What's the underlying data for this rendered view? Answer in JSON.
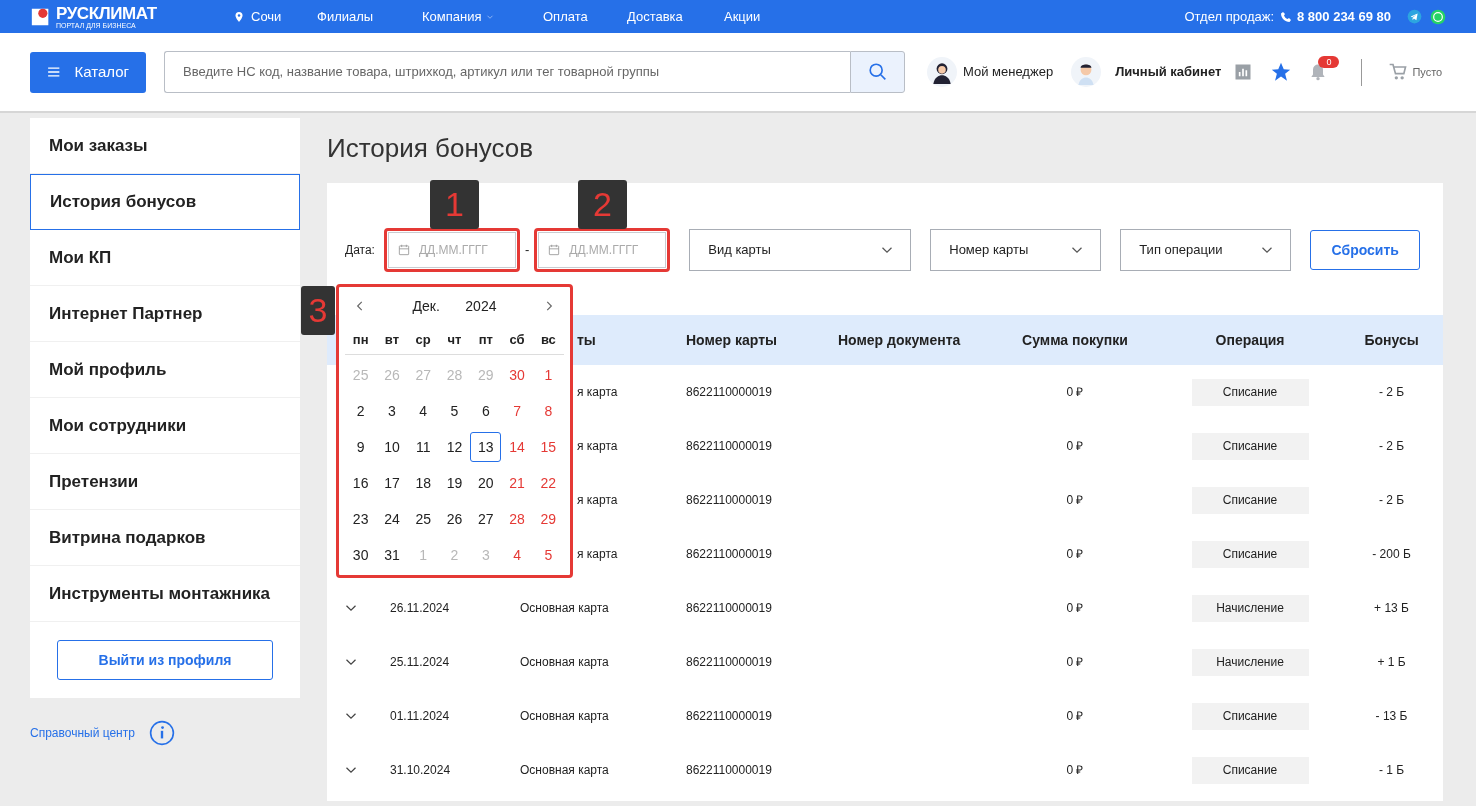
{
  "topbar": {
    "logo": "РУСКЛИМАТ",
    "logo_sub": "ПОРТАЛ ДЛЯ БИЗНЕСА",
    "city": "Сочи",
    "links": [
      {
        "label": "Филиалы",
        "dropdown": false
      },
      {
        "label": "Компания",
        "dropdown": true
      },
      {
        "label": "Оплата",
        "dropdown": false
      },
      {
        "label": "Доставка",
        "dropdown": false
      },
      {
        "label": "Акции",
        "dropdown": false
      }
    ],
    "sales_label": "Отдел продаж:",
    "phone": "8 800 234 69 80"
  },
  "header": {
    "catalog": "Каталог",
    "search_placeholder": "Введите НС код, название товара, штрихкод, артикул или тег товарной группы",
    "manager": "Мой менеджер",
    "cabinet": "Личный кабинет",
    "notifications": "0",
    "cart": "Пусто"
  },
  "sidebar": {
    "items": [
      {
        "label": "Мои заказы",
        "selected": false
      },
      {
        "label": "История бонусов",
        "selected": true
      },
      {
        "label": "Мои КП",
        "selected": false
      },
      {
        "label": "Интернет Партнер",
        "selected": false
      },
      {
        "label": "Мой профиль",
        "selected": false
      },
      {
        "label": "Мои сотрудники",
        "selected": false
      },
      {
        "label": "Претензии",
        "selected": false
      },
      {
        "label": "Витрина подарков",
        "selected": false
      },
      {
        "label": "Инструменты монтажника",
        "selected": false
      }
    ],
    "logout": "Выйти из профиля",
    "help": "Справочный центр"
  },
  "page_title": "История бонусов",
  "filters": {
    "date_label": "Дата:",
    "date_from_placeholder": "ДД.ММ.ГГГГ",
    "separator": "-",
    "date_to_placeholder": "ДД.ММ.ГГГГ",
    "selects": [
      "Вид карты",
      "Номер карты",
      "Тип операции"
    ],
    "reset": "Сбросить"
  },
  "calendar": {
    "month": "Дек.",
    "year": "2024",
    "weekdays": [
      "пн",
      "вт",
      "ср",
      "чт",
      "пт",
      "сб",
      "вс"
    ],
    "days": [
      {
        "d": "25",
        "muted": true,
        "weekend": false,
        "selected": false
      },
      {
        "d": "26",
        "muted": true,
        "weekend": false,
        "selected": false
      },
      {
        "d": "27",
        "muted": true,
        "weekend": false,
        "selected": false
      },
      {
        "d": "28",
        "muted": true,
        "weekend": false,
        "selected": false
      },
      {
        "d": "29",
        "muted": true,
        "weekend": false,
        "selected": false
      },
      {
        "d": "30",
        "muted": true,
        "weekend": true,
        "selected": false
      },
      {
        "d": "1",
        "muted": false,
        "weekend": true,
        "selected": false
      },
      {
        "d": "2",
        "muted": false,
        "weekend": false,
        "selected": false
      },
      {
        "d": "3",
        "muted": false,
        "weekend": false,
        "selected": false
      },
      {
        "d": "4",
        "muted": false,
        "weekend": false,
        "selected": false
      },
      {
        "d": "5",
        "muted": false,
        "weekend": false,
        "selected": false
      },
      {
        "d": "6",
        "muted": false,
        "weekend": false,
        "selected": false
      },
      {
        "d": "7",
        "muted": false,
        "weekend": true,
        "selected": false
      },
      {
        "d": "8",
        "muted": false,
        "weekend": true,
        "selected": false
      },
      {
        "d": "9",
        "muted": false,
        "weekend": false,
        "selected": false
      },
      {
        "d": "10",
        "muted": false,
        "weekend": false,
        "selected": false
      },
      {
        "d": "11",
        "muted": false,
        "weekend": false,
        "selected": false
      },
      {
        "d": "12",
        "muted": false,
        "weekend": false,
        "selected": false
      },
      {
        "d": "13",
        "muted": false,
        "weekend": false,
        "selected": true
      },
      {
        "d": "14",
        "muted": false,
        "weekend": true,
        "selected": false
      },
      {
        "d": "15",
        "muted": false,
        "weekend": true,
        "selected": false
      },
      {
        "d": "16",
        "muted": false,
        "weekend": false,
        "selected": false
      },
      {
        "d": "17",
        "muted": false,
        "weekend": false,
        "selected": false
      },
      {
        "d": "18",
        "muted": false,
        "weekend": false,
        "selected": false
      },
      {
        "d": "19",
        "muted": false,
        "weekend": false,
        "selected": false
      },
      {
        "d": "20",
        "muted": false,
        "weekend": false,
        "selected": false
      },
      {
        "d": "21",
        "muted": false,
        "weekend": true,
        "selected": false
      },
      {
        "d": "22",
        "muted": false,
        "weekend": true,
        "selected": false
      },
      {
        "d": "23",
        "muted": false,
        "weekend": false,
        "selected": false
      },
      {
        "d": "24",
        "muted": false,
        "weekend": false,
        "selected": false
      },
      {
        "d": "25",
        "muted": false,
        "weekend": false,
        "selected": false
      },
      {
        "d": "26",
        "muted": false,
        "weekend": false,
        "selected": false
      },
      {
        "d": "27",
        "muted": false,
        "weekend": false,
        "selected": false
      },
      {
        "d": "28",
        "muted": false,
        "weekend": true,
        "selected": false
      },
      {
        "d": "29",
        "muted": false,
        "weekend": true,
        "selected": false
      },
      {
        "d": "30",
        "muted": false,
        "weekend": false,
        "selected": false
      },
      {
        "d": "31",
        "muted": false,
        "weekend": false,
        "selected": false
      },
      {
        "d": "1",
        "muted": true,
        "weekend": false,
        "selected": false
      },
      {
        "d": "2",
        "muted": true,
        "weekend": false,
        "selected": false
      },
      {
        "d": "3",
        "muted": true,
        "weekend": false,
        "selected": false
      },
      {
        "d": "4",
        "muted": true,
        "weekend": true,
        "selected": false
      },
      {
        "d": "5",
        "muted": true,
        "weekend": true,
        "selected": false
      }
    ]
  },
  "table": {
    "columns": [
      "",
      "",
      "ты",
      "Номер карты",
      "Номер документа",
      "Сумма покупки",
      "Операция",
      "Бонусы"
    ],
    "rows": [
      {
        "covered": true,
        "date": "",
        "card_type": "я карта",
        "card_number": "8622110000019",
        "sum": "0 ₽",
        "operation": "Списание",
        "bonus": "- 2 Б"
      },
      {
        "covered": true,
        "date": "",
        "card_type": "я карта",
        "card_number": "8622110000019",
        "sum": "0 ₽",
        "operation": "Списание",
        "bonus": "- 2 Б"
      },
      {
        "covered": true,
        "date": "",
        "card_type": "я карта",
        "card_number": "8622110000019",
        "sum": "0 ₽",
        "operation": "Списание",
        "bonus": "- 2 Б"
      },
      {
        "covered": true,
        "date": "",
        "card_type": "я карта",
        "card_number": "8622110000019",
        "sum": "0 ₽",
        "operation": "Списание",
        "bonus": "- 200 Б"
      },
      {
        "covered": false,
        "date": "26.11.2024",
        "card_type": "Основная карта",
        "card_number": "8622110000019",
        "sum": "0 ₽",
        "operation": "Начисление",
        "bonus": "+ 13 Б"
      },
      {
        "covered": false,
        "date": "25.11.2024",
        "card_type": "Основная карта",
        "card_number": "8622110000019",
        "sum": "0 ₽",
        "operation": "Начисление",
        "bonus": "+ 1 Б"
      },
      {
        "covered": false,
        "date": "01.11.2024",
        "card_type": "Основная карта",
        "card_number": "8622110000019",
        "sum": "0 ₽",
        "operation": "Списание",
        "bonus": "- 13 Б"
      },
      {
        "covered": false,
        "date": "31.10.2024",
        "card_type": "Основная карта",
        "card_number": "8622110000019",
        "sum": "0 ₽",
        "operation": "Списание",
        "bonus": "- 1 Б"
      }
    ]
  },
  "annotations": [
    {
      "label": "1"
    },
    {
      "label": "2"
    },
    {
      "label": "3"
    }
  ]
}
